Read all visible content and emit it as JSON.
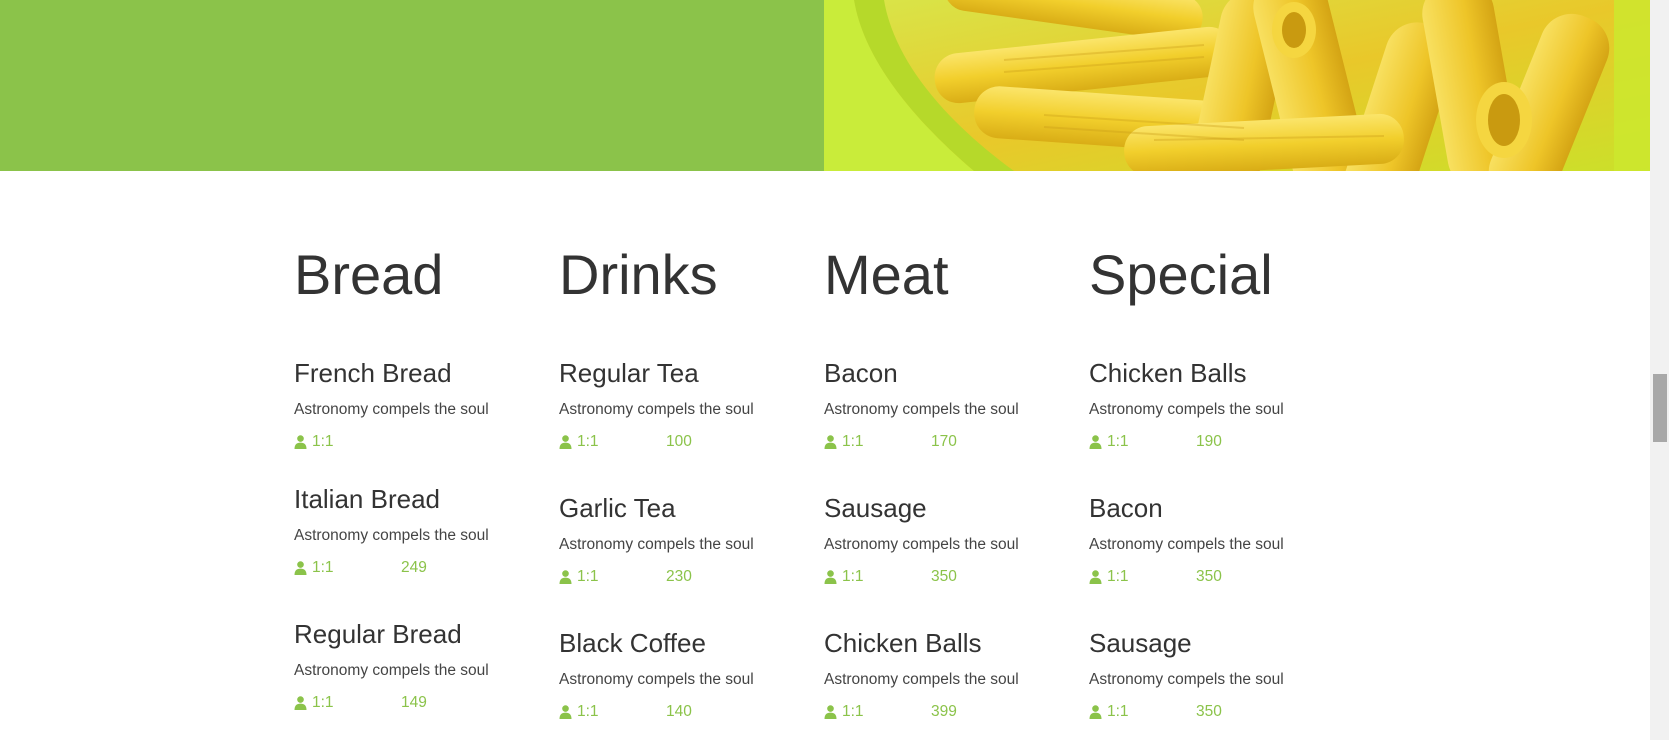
{
  "colors": {
    "accent": "#8bc34a",
    "hero_green": "#8bc34a",
    "text": "#333333"
  },
  "menu": {
    "columns": [
      {
        "title": "Bread",
        "items": [
          {
            "name": "French Bread",
            "description": "Astronomy compels the soul",
            "portion": "1:1",
            "count": ""
          },
          {
            "name": "Italian Bread",
            "description": "Astronomy compels the soul",
            "portion": "1:1",
            "count": "249"
          },
          {
            "name": "Regular Bread",
            "description": "Astronomy compels the soul",
            "portion": "1:1",
            "count": "149"
          }
        ]
      },
      {
        "title": "Drinks",
        "items": [
          {
            "name": "Regular Tea",
            "description": "Astronomy compels the soul",
            "portion": "1:1",
            "count": "100"
          },
          {
            "name": "Garlic Tea",
            "description": "Astronomy compels the soul",
            "portion": "1:1",
            "count": "230"
          },
          {
            "name": "Black Coffee",
            "description": "Astronomy compels the soul",
            "portion": "1:1",
            "count": "140"
          }
        ]
      },
      {
        "title": "Meat",
        "items": [
          {
            "name": "Bacon",
            "description": "Astronomy compels the soul",
            "portion": "1:1",
            "count": "170"
          },
          {
            "name": "Sausage",
            "description": "Astronomy compels the soul",
            "portion": "1:1",
            "count": "350"
          },
          {
            "name": "Chicken Balls",
            "description": "Astronomy compels the soul",
            "portion": "1:1",
            "count": "399"
          }
        ]
      },
      {
        "title": "Special",
        "items": [
          {
            "name": "Chicken Balls",
            "description": "Astronomy compels the soul",
            "portion": "1:1",
            "count": "190"
          },
          {
            "name": "Bacon",
            "description": "Astronomy compels the soul",
            "portion": "1:1",
            "count": "350"
          },
          {
            "name": "Sausage",
            "description": "Astronomy compels the soul",
            "portion": "1:1",
            "count": "350"
          }
        ]
      }
    ]
  }
}
